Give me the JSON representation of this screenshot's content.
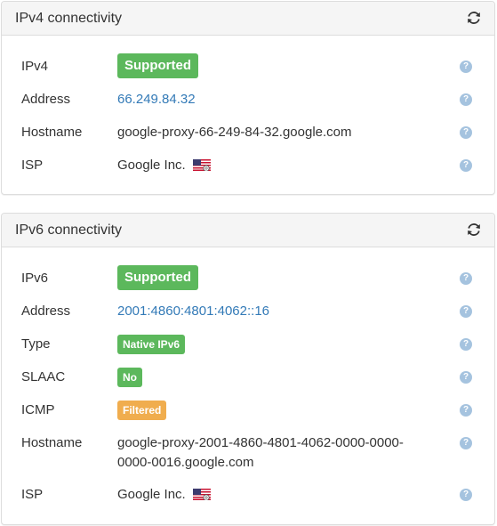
{
  "ipv4": {
    "title": "IPv4 connectivity",
    "refresh_icon": "refresh-icon",
    "rows": {
      "ipv4": {
        "label": "IPv4",
        "value": "Supported"
      },
      "address": {
        "label": "Address",
        "value": "66.249.84.32"
      },
      "hostname": {
        "label": "Hostname",
        "value": "google-proxy-66-249-84-32.google.com"
      },
      "isp": {
        "label": "ISP",
        "value": "Google Inc."
      }
    }
  },
  "ipv6": {
    "title": "IPv6 connectivity",
    "refresh_icon": "refresh-icon",
    "rows": {
      "ipv6": {
        "label": "IPv6",
        "value": "Supported"
      },
      "address": {
        "label": "Address",
        "value": "2001:4860:4801:4062::16"
      },
      "type": {
        "label": "Type",
        "value": "Native IPv6"
      },
      "slaac": {
        "label": "SLAAC",
        "value": "No"
      },
      "icmp": {
        "label": "ICMP",
        "value": "Filtered"
      },
      "hostname": {
        "label": "Hostname",
        "value": "google-proxy-2001-4860-4801-4062-0000-0000-0000-0016.google.com"
      },
      "isp": {
        "label": "ISP",
        "value": "Google Inc."
      }
    }
  },
  "help_glyph": "?",
  "colors": {
    "success": "#5cb85c",
    "warning": "#f0ad4e",
    "link": "#337ab7",
    "help_icon": "#a5c3df",
    "heading_bg": "#f5f5f5"
  }
}
